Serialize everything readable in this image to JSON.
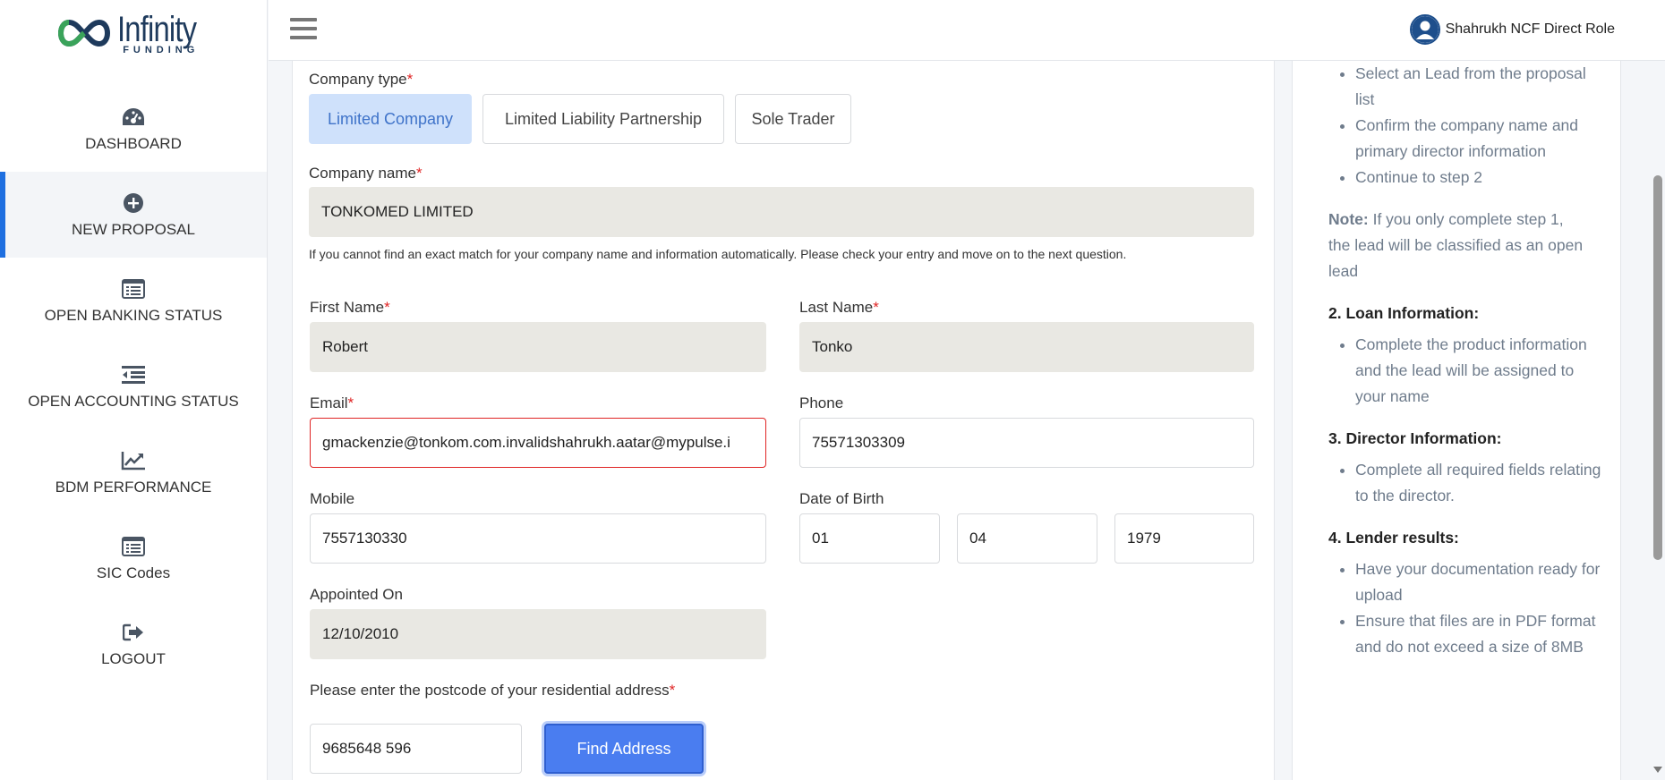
{
  "brand": {
    "name": "Infinity",
    "sub": "FUNDING"
  },
  "nav": [
    {
      "label": "DASHBOARD",
      "icon": "dashboard-icon"
    },
    {
      "label": "NEW PROPOSAL",
      "icon": "plus-circle-icon",
      "active": true
    },
    {
      "label": "OPEN BANKING STATUS",
      "icon": "list-card-icon"
    },
    {
      "label": "OPEN ACCOUNTING STATUS",
      "icon": "indent-list-icon"
    },
    {
      "label": "BDM PERFORMANCE",
      "icon": "line-chart-icon"
    },
    {
      "label": "SIC Codes",
      "icon": "list-card-icon"
    },
    {
      "label": "LOGOUT",
      "icon": "logout-icon"
    }
  ],
  "header": {
    "user_name": "Shahrukh NCF Direct Role"
  },
  "form": {
    "company_type": {
      "label": "Company type",
      "required": "*",
      "options": [
        "Limited Company",
        "Limited Liability Partnership",
        "Sole Trader"
      ],
      "selected": "Limited Company"
    },
    "company_name": {
      "label": "Company name",
      "required": "*",
      "value": "TONKOMED LIMITED"
    },
    "hint": "If you cannot find an exact match for your company name and information automatically. Please check your entry and move on to the next question.",
    "first_name": {
      "label": "First Name",
      "required": "*",
      "value": "Robert"
    },
    "last_name": {
      "label": "Last Name",
      "required": "*",
      "value": "Tonko"
    },
    "email": {
      "label": "Email",
      "required": "*",
      "value": "gmackenzie@tonkom.com.invalidshahrukh.aatar@mypulse.i"
    },
    "phone": {
      "label": "Phone",
      "value": "75571303309"
    },
    "mobile": {
      "label": "Mobile",
      "value": "7557130330"
    },
    "dob": {
      "label": "Date of Birth",
      "day": "01",
      "month": "04",
      "year": "1979"
    },
    "appointed": {
      "label": "Appointed On",
      "value": "12/10/2010"
    },
    "postcode": {
      "label": "Please enter the postcode of your residential address",
      "required": "*",
      "value": "9685648 596"
    },
    "find_button": "Find Address"
  },
  "help": {
    "step1_items": [
      "Select an Lead from the proposal list",
      "Confirm the company name and primary director information",
      "Continue to step 2"
    ],
    "note_label": "Note:",
    "note_text": "If you only complete step 1, the lead will be classified as an open lead",
    "step2_title": "2. Loan Information:",
    "step2_items": [
      "Complete the product information and the lead will be assigned to your name"
    ],
    "step3_title": "3. Director Information:",
    "step3_items": [
      "Complete all required fields relating to the director."
    ],
    "step4_title": "4. Lender results:",
    "step4_items": [
      "Have your documentation ready for upload",
      "Ensure that files are in PDF format and do not exceed a size of 8MB"
    ]
  },
  "colors": {
    "accent": "#1e6fe0",
    "button": "#4a7df0",
    "readonly_bg": "#e9e8e3",
    "error": "#e02424",
    "selected_seg_bg": "#cfe1fb"
  }
}
